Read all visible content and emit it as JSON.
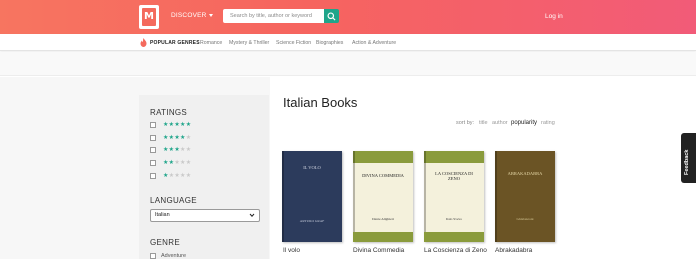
{
  "header": {
    "logo_letter": "M",
    "discover_label": "DISCOVER",
    "search_placeholder": "Search by title, author or keyword",
    "login_label": "Log in",
    "accent": "#f46a5d",
    "search_button_color": "#1fa58a"
  },
  "genre_bar": {
    "popular_label": "POPULAR GENRES",
    "links": [
      "Romance",
      "Mystery & Thriller",
      "Science Fiction",
      "Biographies",
      "Action & Adventure"
    ]
  },
  "sidebar": {
    "ratings_title": "RATINGS",
    "ratings": [
      {
        "stars": 5
      },
      {
        "stars": 4
      },
      {
        "stars": 3
      },
      {
        "stars": 2
      },
      {
        "stars": 1
      }
    ],
    "language_title": "LANGUAGE",
    "language_selected": "Italian",
    "genre_title": "GENRE",
    "genre_options": [
      "Adventure"
    ]
  },
  "main": {
    "title": "Italian Books",
    "sort_label": "sort by:",
    "sort_options": [
      "title",
      "author",
      "popularity",
      "rating"
    ],
    "sort_active": "popularity",
    "books": [
      {
        "label": "Il volo",
        "cover_title": "IL VOLO",
        "cover_author": "ARTURO GRAF",
        "cover_color": "#2c3b5c",
        "band_color": "#2c3b5c"
      },
      {
        "label": "Divina Commedia",
        "cover_title": "DIVINA COMMEDIA",
        "cover_author": "Dante Alighieri",
        "cover_color": "#f4f1dc",
        "band_color": "#8a9b3c"
      },
      {
        "label": "La Coscienza di Zeno",
        "cover_title": "LA COSCIENZA DI ZENO",
        "cover_author": "Italo Svevo",
        "cover_color": "#f4f1dc",
        "band_color": "#8a9b3c"
      },
      {
        "label": "Abrakadabra",
        "cover_title": "ABRAKADABRA",
        "cover_author": "Ghislanzoni",
        "cover_color": "#6b5425",
        "band_color": "#6b5425"
      }
    ]
  },
  "feedback_label": "Feedback"
}
